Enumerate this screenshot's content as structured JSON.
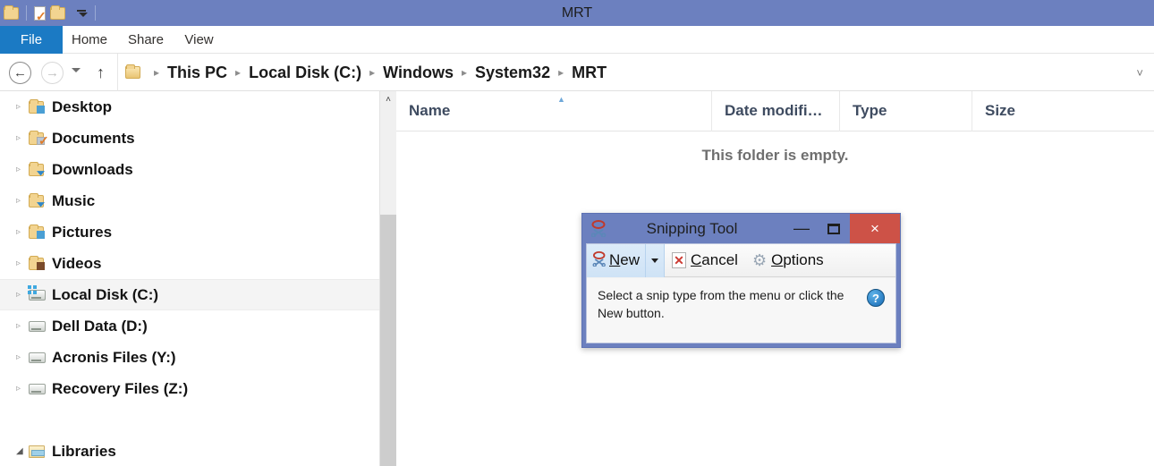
{
  "window": {
    "title": "MRT",
    "quick_access": [
      {
        "name": "folder-icon",
        "label": ""
      },
      {
        "name": "document-check-icon",
        "label": ""
      },
      {
        "name": "folder-icon",
        "label": ""
      },
      {
        "name": "customize-caret-icon",
        "label": ""
      }
    ]
  },
  "ribbon": {
    "file_tab": "File",
    "tabs": [
      "Home",
      "Share",
      "View"
    ]
  },
  "addressbar": {
    "back_glyph": "←",
    "forward_glyph": "→",
    "up_glyph": "↑",
    "dropdown_glyph": "˅",
    "separator": "▸",
    "crumbs": [
      "This PC",
      "Local Disk (C:)",
      "Windows",
      "System32",
      "MRT"
    ]
  },
  "sidebar": {
    "items": [
      {
        "label": "Desktop",
        "icon": "folder-desktop-icon",
        "twisty": "▹",
        "expanded": false,
        "selected": false
      },
      {
        "label": "Documents",
        "icon": "folder-documents-icon",
        "twisty": "▹",
        "expanded": false,
        "selected": false
      },
      {
        "label": "Downloads",
        "icon": "folder-downloads-icon",
        "twisty": "▹",
        "expanded": false,
        "selected": false
      },
      {
        "label": "Music",
        "icon": "folder-music-icon",
        "twisty": "▹",
        "expanded": false,
        "selected": false
      },
      {
        "label": "Pictures",
        "icon": "folder-pictures-icon",
        "twisty": "▹",
        "expanded": false,
        "selected": false
      },
      {
        "label": "Videos",
        "icon": "folder-videos-icon",
        "twisty": "▹",
        "expanded": false,
        "selected": false
      },
      {
        "label": "Local Disk (C:)",
        "icon": "system-drive-icon",
        "twisty": "▹",
        "expanded": false,
        "selected": true
      },
      {
        "label": "Dell Data (D:)",
        "icon": "drive-icon",
        "twisty": "▹",
        "expanded": false,
        "selected": false
      },
      {
        "label": "Acronis Files (Y:)",
        "icon": "drive-icon",
        "twisty": "▹",
        "expanded": false,
        "selected": false
      },
      {
        "label": "Recovery Files (Z:)",
        "icon": "drive-icon",
        "twisty": "▹",
        "expanded": false,
        "selected": false
      },
      {
        "label": "Libraries",
        "icon": "libraries-icon",
        "twisty": "◢",
        "expanded": true,
        "selected": false
      }
    ],
    "scrollbar": {
      "up_glyph": "˄"
    }
  },
  "filelist": {
    "columns": [
      {
        "label": "Name",
        "sorted": true,
        "sort_glyph": "▲"
      },
      {
        "label": "Date modifi…",
        "sorted": false,
        "sort_glyph": ""
      },
      {
        "label": "Type",
        "sorted": false,
        "sort_glyph": ""
      },
      {
        "label": "Size",
        "sorted": false,
        "sort_glyph": ""
      }
    ],
    "empty_message": "This folder is empty."
  },
  "snipping_tool": {
    "title": "Snipping Tool",
    "app_icon": "scissors-icon",
    "minimize_glyph": "—",
    "close_glyph": "×",
    "toolbar": {
      "new_prefix": "",
      "new_accel": "N",
      "new_rest": "ew",
      "cancel_accel": "C",
      "cancel_rest": "ancel",
      "options_accel": "O",
      "options_rest": "ptions",
      "new_icon": "scissors-icon",
      "cancel_icon": "cancel-x-icon",
      "options_icon": "gear-icon"
    },
    "status_text": "Select a snip type from the menu or click the New button.",
    "help_glyph": "?"
  },
  "colors": {
    "titlebar": "#6c80bf",
    "file_tab": "#1b7ac4",
    "close_button": "#cd5247",
    "column_header_text": "#3e4b60",
    "selection": "#f4f4f4"
  }
}
